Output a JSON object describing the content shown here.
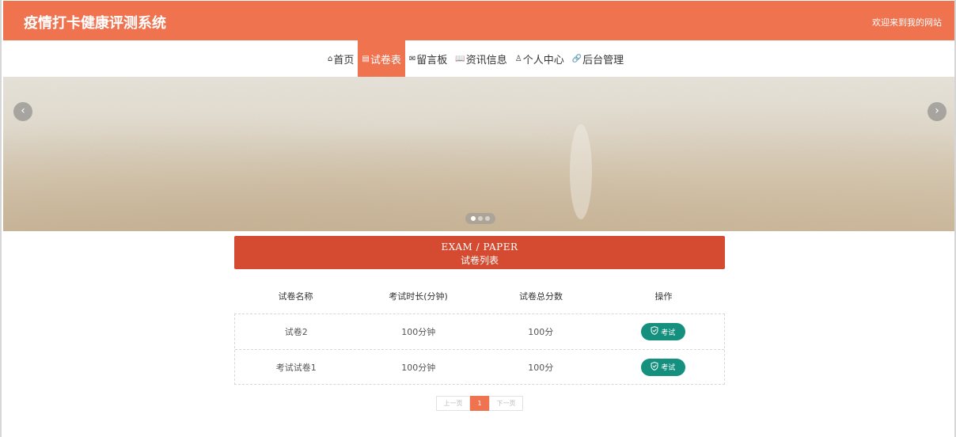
{
  "header": {
    "site_title": "疫情打卡健康评测系统",
    "welcome": "欢迎来到我的网站"
  },
  "nav": [
    {
      "icon": "home-icon",
      "glyph": "⌂",
      "label": "首页",
      "active": false
    },
    {
      "icon": "exam-paper-icon",
      "glyph": "▤",
      "label": "试卷表",
      "active": true
    },
    {
      "icon": "message-icon",
      "glyph": "✉",
      "label": "留言板",
      "active": false
    },
    {
      "icon": "news-book-icon",
      "glyph": "📖",
      "label": "资讯信息",
      "active": false
    },
    {
      "icon": "user-icon",
      "glyph": "♙",
      "label": "个人中心",
      "active": false
    },
    {
      "icon": "link-icon",
      "glyph": "🔗",
      "label": "后台管理",
      "active": false
    }
  ],
  "banner": {
    "prev_glyph": "‹",
    "next_glyph": "›",
    "slides": 3,
    "active_slide": 0
  },
  "section": {
    "title_en": "EXAM / PAPER",
    "title_cn": "试卷列表"
  },
  "table": {
    "columns": [
      "试卷名称",
      "考试时长(分钟)",
      "试卷总分数",
      "操作"
    ],
    "rows": [
      {
        "name": "试卷2",
        "duration": "100分钟",
        "score": "100分",
        "action": "考试"
      },
      {
        "name": "考试试卷1",
        "duration": "100分钟",
        "score": "100分",
        "action": "考试"
      }
    ]
  },
  "pagination": {
    "prev": "上一页",
    "current": "1",
    "next": "下一页"
  },
  "colors": {
    "header_bg": "#f07350",
    "section_bg": "#d54b31",
    "button_bg": "#16907e"
  }
}
